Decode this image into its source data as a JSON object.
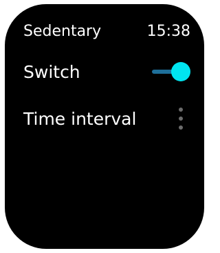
{
  "header": {
    "title": "Sedentary",
    "time": "15:38"
  },
  "settings": {
    "switch": {
      "label": "Switch",
      "on": true
    },
    "interval": {
      "label": "Time interval",
      "icon": "more-vertical-icon"
    }
  },
  "colors": {
    "background": "#000000",
    "text": "#ffffff",
    "accent": "#00e5f0",
    "track": "#1e6f9a",
    "muted": "#6c6c6c"
  }
}
